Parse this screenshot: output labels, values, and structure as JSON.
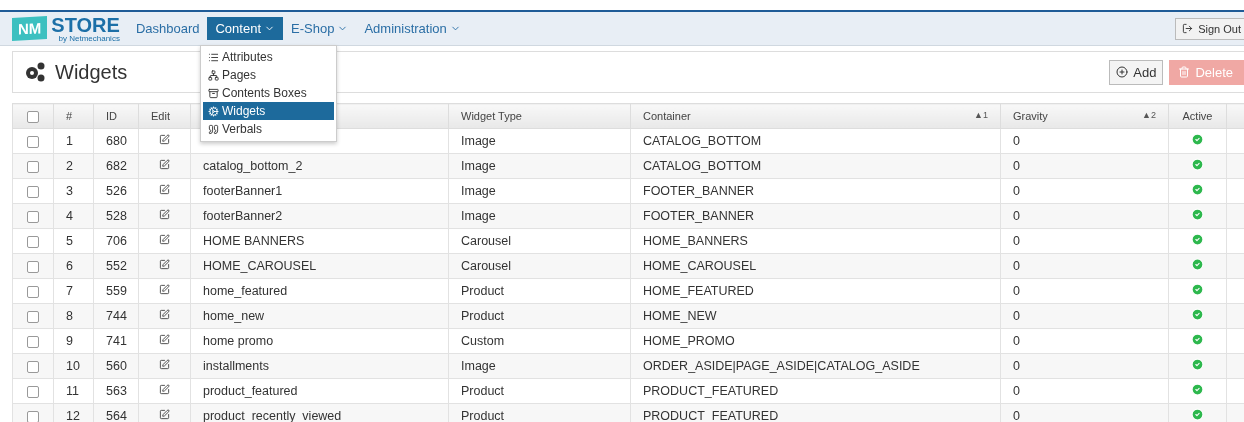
{
  "logo": {
    "badge": "NM",
    "name": "STORE",
    "tagline": "by Netmechanics"
  },
  "nav": [
    {
      "label": "Dashboard",
      "dropdown": false,
      "selected": false
    },
    {
      "label": "Content",
      "dropdown": true,
      "selected": true
    },
    {
      "label": "E-Shop",
      "dropdown": true,
      "selected": false
    },
    {
      "label": "Administration",
      "dropdown": true,
      "selected": false
    }
  ],
  "sign_out": "Sign Out",
  "menu": [
    {
      "label": "Attributes",
      "kind": "list",
      "selected": false
    },
    {
      "label": "Pages",
      "kind": "sitemap",
      "selected": false
    },
    {
      "label": "Contents Boxes",
      "kind": "archive",
      "selected": false
    },
    {
      "label": "Widgets",
      "kind": "cogs",
      "selected": true
    },
    {
      "label": "Verbals",
      "kind": "quote",
      "selected": false
    }
  ],
  "page_title": "Widgets",
  "actions": {
    "add": "Add",
    "delete": "Delete",
    "delete_disabled": true
  },
  "table": {
    "select_all_checked": false,
    "columns": [
      {
        "label": "#"
      },
      {
        "label": "ID"
      },
      {
        "label": "Edit"
      },
      {
        "label": "Widget Type"
      },
      {
        "label": "Container",
        "sort": "▲1"
      },
      {
        "label": "Gravity",
        "sort": "▲2"
      },
      {
        "label": "Active"
      }
    ],
    "rows": [
      {
        "checked": false,
        "num": "1",
        "id": "680",
        "type": "Image",
        "container": "CATALOG_BOTTOM",
        "gravity": "0",
        "active": true
      },
      {
        "checked": false,
        "num": "2",
        "id": "682",
        "name": "catalog_bottom_2",
        "type": "Image",
        "container": "CATALOG_BOTTOM",
        "gravity": "0",
        "active": true
      },
      {
        "checked": false,
        "num": "3",
        "id": "526",
        "name": "footerBanner1",
        "type": "Image",
        "container": "FOOTER_BANNER",
        "gravity": "0",
        "active": true
      },
      {
        "checked": false,
        "num": "4",
        "id": "528",
        "name": "footerBanner2",
        "type": "Image",
        "container": "FOOTER_BANNER",
        "gravity": "0",
        "active": true
      },
      {
        "checked": false,
        "num": "5",
        "id": "706",
        "name": "HOME BANNERS",
        "type": "Carousel",
        "container": "HOME_BANNERS",
        "gravity": "0",
        "active": true
      },
      {
        "checked": false,
        "num": "6",
        "id": "552",
        "name": "HOME_CAROUSEL",
        "type": "Carousel",
        "container": "HOME_CAROUSEL",
        "gravity": "0",
        "active": true
      },
      {
        "checked": false,
        "num": "7",
        "id": "559",
        "name": "home_featured",
        "type": "Product",
        "container": "HOME_FEATURED",
        "gravity": "0",
        "active": true
      },
      {
        "checked": false,
        "num": "8",
        "id": "744",
        "name": "home_new",
        "type": "Product",
        "container": "HOME_NEW",
        "gravity": "0",
        "active": true
      },
      {
        "checked": false,
        "num": "9",
        "id": "741",
        "name": "home promo",
        "type": "Custom",
        "container": "HOME_PROMO",
        "gravity": "0",
        "active": true
      },
      {
        "checked": false,
        "num": "10",
        "id": "560",
        "name": "installments",
        "type": "Image",
        "container": "ORDER_ASIDE|PAGE_ASIDE|CATALOG_ASIDE",
        "gravity": "0",
        "active": true
      },
      {
        "checked": false,
        "num": "11",
        "id": "563",
        "name": "product_featured",
        "type": "Product",
        "container": "PRODUCT_FEATURED",
        "gravity": "0",
        "active": true
      },
      {
        "checked": false,
        "num": "12",
        "id": "564",
        "name": "product_recently_viewed",
        "type": "Product",
        "container": "PRODUCT_FEATURED",
        "gravity": "0",
        "active": true
      }
    ]
  }
}
